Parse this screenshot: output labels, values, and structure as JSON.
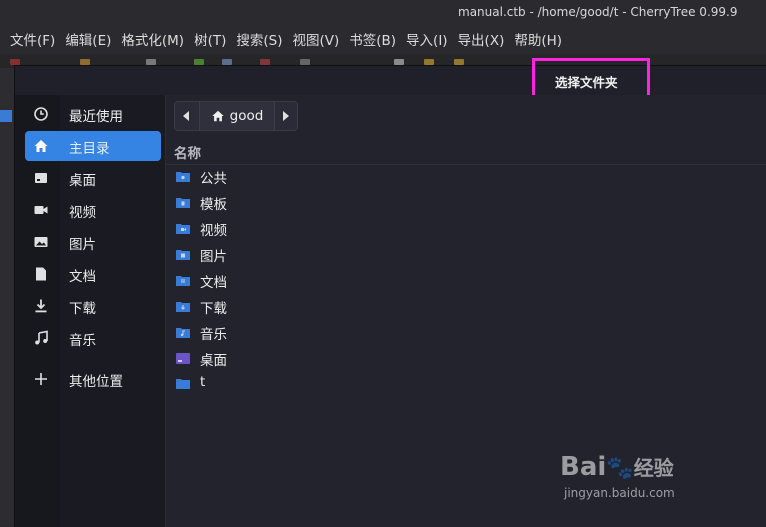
{
  "window": {
    "title": "manual.ctb - /home/good/t - CherryTree 0.99.9"
  },
  "menubar": {
    "items": [
      "文件(F)",
      "编辑(E)",
      "格式化(M)",
      "树(T)",
      "搜索(S)",
      "视图(V)",
      "书签(B)",
      "导入(I)",
      "导出(X)",
      "帮助(H)"
    ]
  },
  "dialog": {
    "title": "选择文件夹",
    "highlight_color": "#ff25e0",
    "sidebar": {
      "items": [
        {
          "label": "最近使用",
          "icon": "clock-icon",
          "active": false
        },
        {
          "label": "主目录",
          "icon": "home-icon",
          "active": true
        },
        {
          "label": "桌面",
          "icon": "desktop-icon",
          "active": false
        },
        {
          "label": "视频",
          "icon": "video-camera-icon",
          "active": false
        },
        {
          "label": "图片",
          "icon": "image-icon",
          "active": false
        },
        {
          "label": "文档",
          "icon": "document-icon",
          "active": false
        },
        {
          "label": "下载",
          "icon": "download-icon",
          "active": false
        },
        {
          "label": "音乐",
          "icon": "music-note-icon",
          "active": false
        },
        {
          "label": "其他位置",
          "icon": "plus-icon",
          "active": false
        }
      ]
    },
    "pathbar": {
      "current": "good"
    },
    "file_list": {
      "column_header": "名称",
      "rows": [
        {
          "name": "公共",
          "icon": "folder-public-icon"
        },
        {
          "name": "模板",
          "icon": "folder-templates-icon"
        },
        {
          "name": "视频",
          "icon": "folder-videos-icon"
        },
        {
          "name": "图片",
          "icon": "folder-pictures-icon"
        },
        {
          "name": "文档",
          "icon": "folder-documents-icon"
        },
        {
          "name": "下载",
          "icon": "folder-download-icon"
        },
        {
          "name": "音乐",
          "icon": "folder-music-icon"
        },
        {
          "name": "桌面",
          "icon": "folder-desktop-icon"
        },
        {
          "name": "t",
          "icon": "folder-icon"
        }
      ]
    }
  },
  "colors": {
    "accent": "#3584e4",
    "folder": "#3a7bd5"
  },
  "watermark": {
    "brand": "Bai",
    "brand_suffix": "经验",
    "url": "jingyan.baidu.com"
  }
}
